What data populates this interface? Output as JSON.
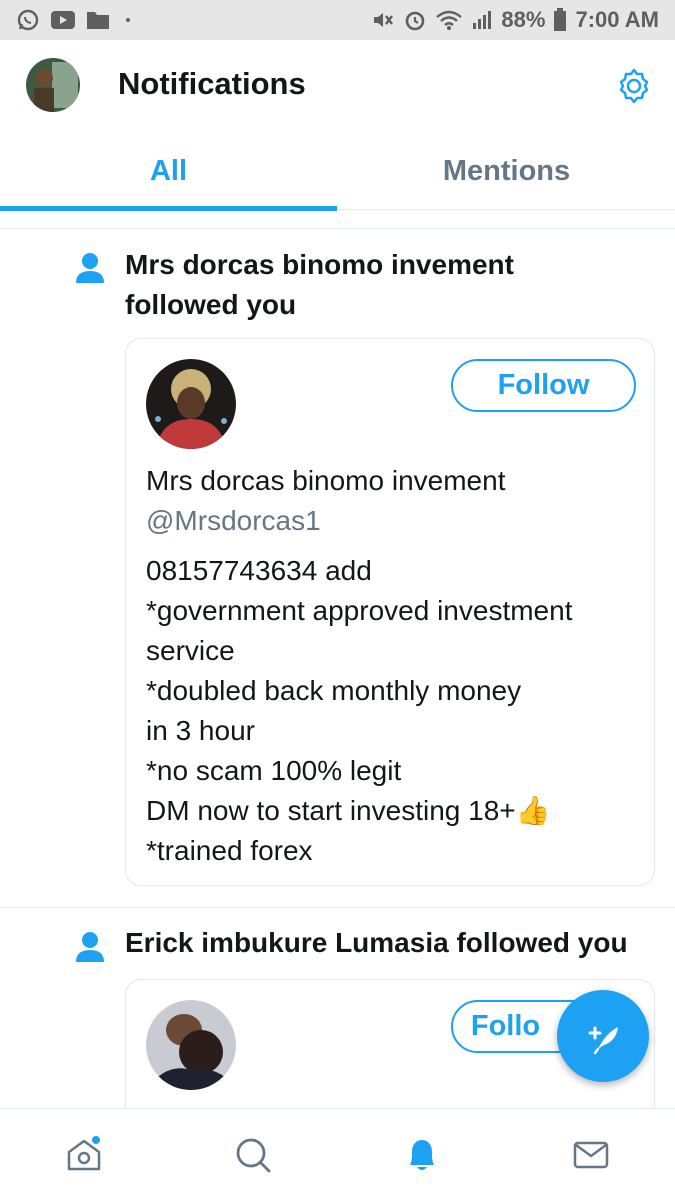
{
  "status_bar": {
    "battery": "88%",
    "time": "7:00 AM",
    "icons": [
      "whatsapp-icon",
      "youtube-icon",
      "folder-icon",
      "mute-icon",
      "alarm-icon",
      "wifi-icon",
      "signal-icon",
      "battery-icon"
    ]
  },
  "header": {
    "title": "Notifications",
    "settings_icon": "gear-icon"
  },
  "tabs": [
    {
      "label": "All",
      "active": true
    },
    {
      "label": "Mentions",
      "active": false
    }
  ],
  "notifications": [
    {
      "text_line1": "Mrs dorcas binomo invement",
      "text_line2": "followed you",
      "card": {
        "follow_label": "Follow",
        "name": "Mrs dorcas binomo invement",
        "handle": "@Mrsdorcas1",
        "bio": [
          "08157743634 add",
          "*government approved investment",
          "service",
          "*doubled back monthly money",
          "in 3 hour",
          "*no scam 100% legit",
          "DM now to start investing 18+",
          "*trained forex"
        ],
        "bio_emoji": "👍"
      }
    },
    {
      "text_line1": "Erick imbukure Lumasia followed you",
      "card": {
        "follow_label": "Follo"
      }
    }
  ],
  "colors": {
    "accent": "#1da1f2",
    "secondary_text": "#657786",
    "primary_text": "#14171a"
  },
  "bottom_nav": [
    "home-icon",
    "search-icon",
    "notifications-bell-icon",
    "messages-icon"
  ]
}
